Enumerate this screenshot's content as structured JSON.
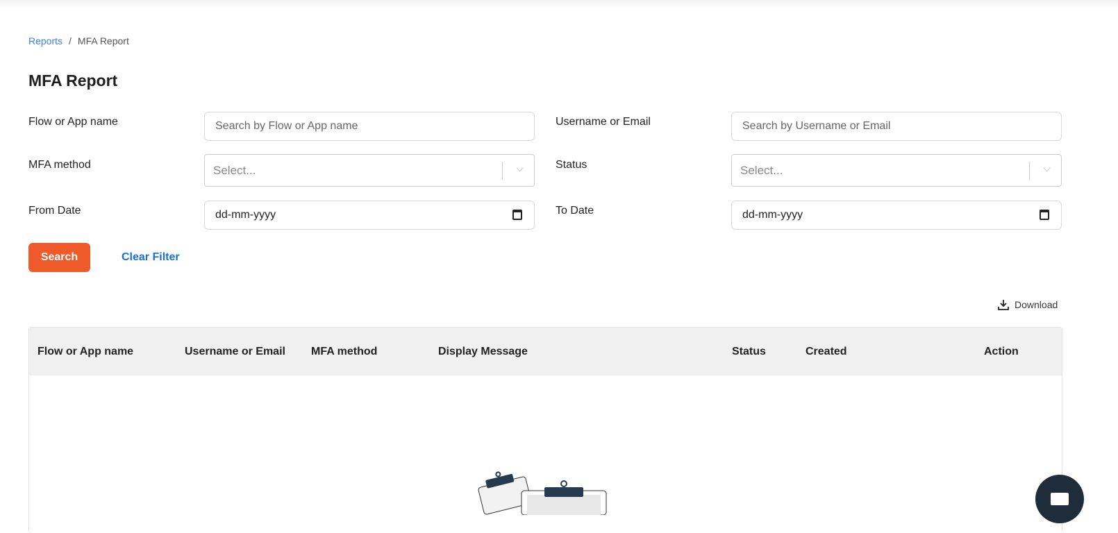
{
  "breadcrumb": {
    "parent": "Reports",
    "current": "MFA Report"
  },
  "title": "MFA Report",
  "filters": {
    "flow_label": "Flow or App name",
    "flow_placeholder": "Search by Flow or App name",
    "user_label": "Username or Email",
    "user_placeholder": "Search by Username or Email",
    "mfa_label": "MFA method",
    "mfa_value": "Select...",
    "status_label": "Status",
    "status_value": "Select...",
    "from_label": "From Date",
    "from_value": "dd-mm-yyyy",
    "to_label": "To Date",
    "to_value": "dd-mm-yyyy"
  },
  "actions": {
    "search": "Search",
    "clear": "Clear Filter",
    "download": "Download"
  },
  "table": {
    "columns": [
      "Flow or App name",
      "Username or Email",
      "MFA method",
      "Display Message",
      "Status",
      "Created",
      "Action"
    ]
  }
}
